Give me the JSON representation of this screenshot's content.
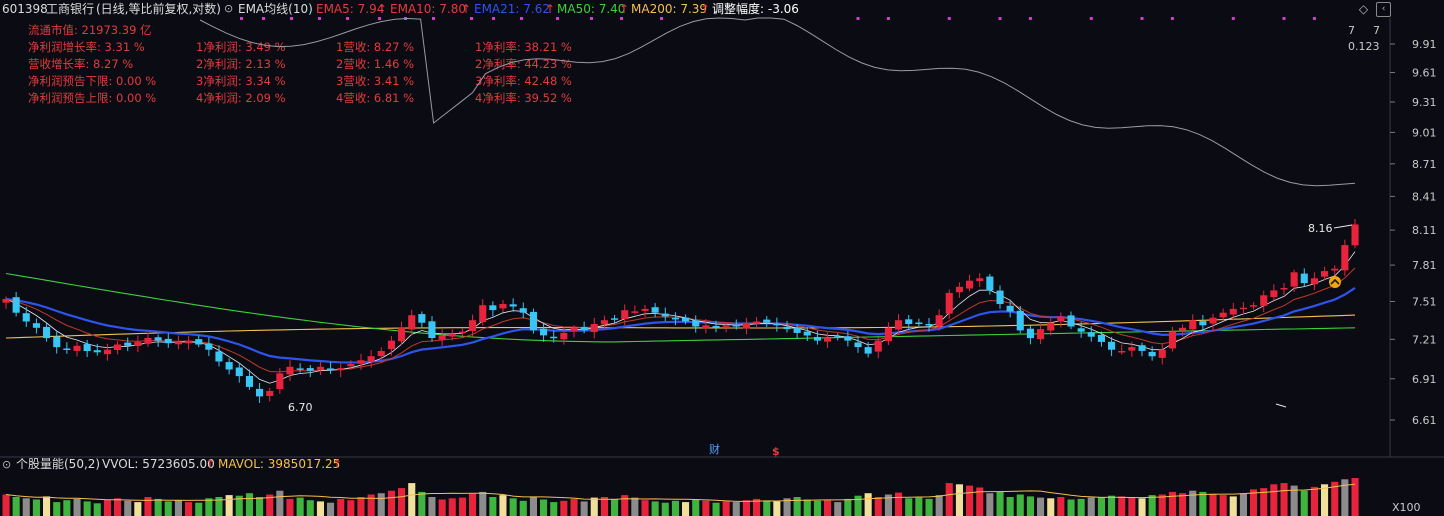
{
  "header": {
    "code": "601398",
    "name": "工商银行",
    "mode": "(日线,等比前复权,对数)",
    "indicator": "EMA均线(10)",
    "ema5": "EMA5: 7.94",
    "ema10": "EMA10: 7.80",
    "ema21": "EMA21: 7.62",
    "ma50": "MA50: 7.40",
    "ma200": "MA200: 7.39",
    "adjust": "调整幅度: -3.06",
    "up_arrow": "↑",
    "colors": {
      "ema5": "#e23c3c",
      "ema10": "#e23c3c",
      "ema21": "#2f54eb",
      "ma50": "#3ad13a",
      "ma200": "#f2c14e",
      "adjust": "#ffffff"
    }
  },
  "fundamentals": {
    "col1": [
      "流通市值: 21973.39 亿",
      "净利润增长率: 3.31 %",
      "营收增长率: 8.27 %",
      "净利润预告下限: 0.00 %",
      "净利润预告上限: 0.00 %"
    ],
    "col2": [
      "1净利润: 3.49 %",
      "2净利润: 2.13 %",
      "3净利润: 3.34 %",
      "4净利润: 2.09 %"
    ],
    "col3": [
      "1营收: 8.27 %",
      "2营收: 1.46 %",
      "3营收: 3.41 %",
      "4营收: 6.81 %"
    ],
    "col4": [
      "1净利率: 38.21 %",
      "2净利率: 44.23 %",
      "3净利率: 42.48 %",
      "4净利率: 39.52 %"
    ]
  },
  "right_scale": {
    "top_a": "7",
    "top_b": "7",
    "top_c": "0.123",
    "labels": [
      "9.91",
      "9.61",
      "9.31",
      "9.01",
      "8.71",
      "8.41",
      "8.11",
      "7.81",
      "7.51",
      "7.21",
      "6.91",
      "6.61"
    ]
  },
  "annotations": {
    "high_label": "8.16",
    "low_label": "6.70",
    "cai": "财",
    "dollar": "$"
  },
  "volume_header": {
    "title": "个股量能(50,2)",
    "vol": "VVOL: 5723605.00",
    "mavol": "MAVOL: 3985017.25",
    "up_arrow": "↑",
    "multiplier": "X100"
  },
  "chart_data": {
    "type": "candlestick",
    "y_axis": {
      "scale": "log",
      "ticks": [
        9.91,
        9.61,
        9.31,
        9.01,
        8.71,
        8.41,
        8.11,
        7.81,
        7.51,
        7.21,
        6.91,
        6.61
      ]
    },
    "closes": [
      7.53,
      7.42,
      7.35,
      7.3,
      7.22,
      7.15,
      7.13,
      7.16,
      7.12,
      7.11,
      7.13,
      7.17,
      7.16,
      7.19,
      7.22,
      7.2,
      7.18,
      7.19,
      7.2,
      7.17,
      7.13,
      7.04,
      6.98,
      6.93,
      6.85,
      6.78,
      6.82,
      6.95,
      7.0,
      6.98,
      6.97,
      7.0,
      6.98,
      6.99,
      7.02,
      7.05,
      7.08,
      7.12,
      7.2,
      7.3,
      7.4,
      7.34,
      7.22,
      7.24,
      7.25,
      7.27,
      7.36,
      7.48,
      7.44,
      7.49,
      7.47,
      7.42,
      7.28,
      7.24,
      7.22,
      7.26,
      7.3,
      7.28,
      7.33,
      7.36,
      7.37,
      7.44,
      7.43,
      7.45,
      7.42,
      7.39,
      7.37,
      7.35,
      7.31,
      7.32,
      7.3,
      7.32,
      7.31,
      7.33,
      7.35,
      7.34,
      7.32,
      7.29,
      7.26,
      7.24,
      7.2,
      7.22,
      7.23,
      7.2,
      7.15,
      7.1,
      7.2,
      7.3,
      7.36,
      7.33,
      7.34,
      7.32,
      7.4,
      7.58,
      7.63,
      7.68,
      7.7,
      7.6,
      7.49,
      7.43,
      7.28,
      7.22,
      7.29,
      7.34,
      7.39,
      7.31,
      7.27,
      7.23,
      7.19,
      7.13,
      7.12,
      7.15,
      7.12,
      7.08,
      7.13,
      7.27,
      7.3,
      7.36,
      7.32,
      7.38,
      7.42,
      7.45,
      7.46,
      7.48,
      7.56,
      7.6,
      7.62,
      7.75,
      7.66,
      7.7,
      7.76,
      7.78,
      7.98,
      8.16
    ],
    "volume": [
      34,
      30,
      28,
      26,
      31,
      22,
      25,
      27,
      23,
      20,
      26,
      28,
      24,
      22,
      30,
      27,
      23,
      25,
      22,
      21,
      28,
      30,
      33,
      32,
      36,
      30,
      34,
      40,
      27,
      29,
      25,
      23,
      21,
      27,
      25,
      30,
      34,
      36,
      40,
      44,
      52,
      38,
      30,
      26,
      28,
      29,
      35,
      38,
      30,
      33,
      28,
      24,
      30,
      26,
      22,
      24,
      27,
      23,
      29,
      30,
      27,
      33,
      29,
      25,
      23,
      21,
      24,
      22,
      26,
      24,
      21,
      23,
      22,
      25,
      27,
      24,
      23,
      28,
      30,
      26,
      24,
      25,
      22,
      27,
      32,
      36,
      30,
      34,
      37,
      28,
      29,
      27,
      33,
      52,
      50,
      48,
      45,
      36,
      38,
      30,
      34,
      31,
      29,
      28,
      30,
      26,
      27,
      29,
      30,
      32,
      31,
      30,
      28,
      33,
      34,
      38,
      36,
      40,
      38,
      35,
      33,
      31,
      36,
      42,
      44,
      50,
      52,
      48,
      40,
      46,
      50,
      54,
      58,
      60
    ],
    "series": [
      {
        "name": "EMA5",
        "color": "#e23c3c"
      },
      {
        "name": "EMA10",
        "color": "#e23c3c"
      },
      {
        "name": "EMA21",
        "color": "#2f54eb"
      },
      {
        "name": "MA50",
        "color": "#3ad13a"
      },
      {
        "name": "MA200",
        "color": "#f2c14e"
      }
    ]
  }
}
